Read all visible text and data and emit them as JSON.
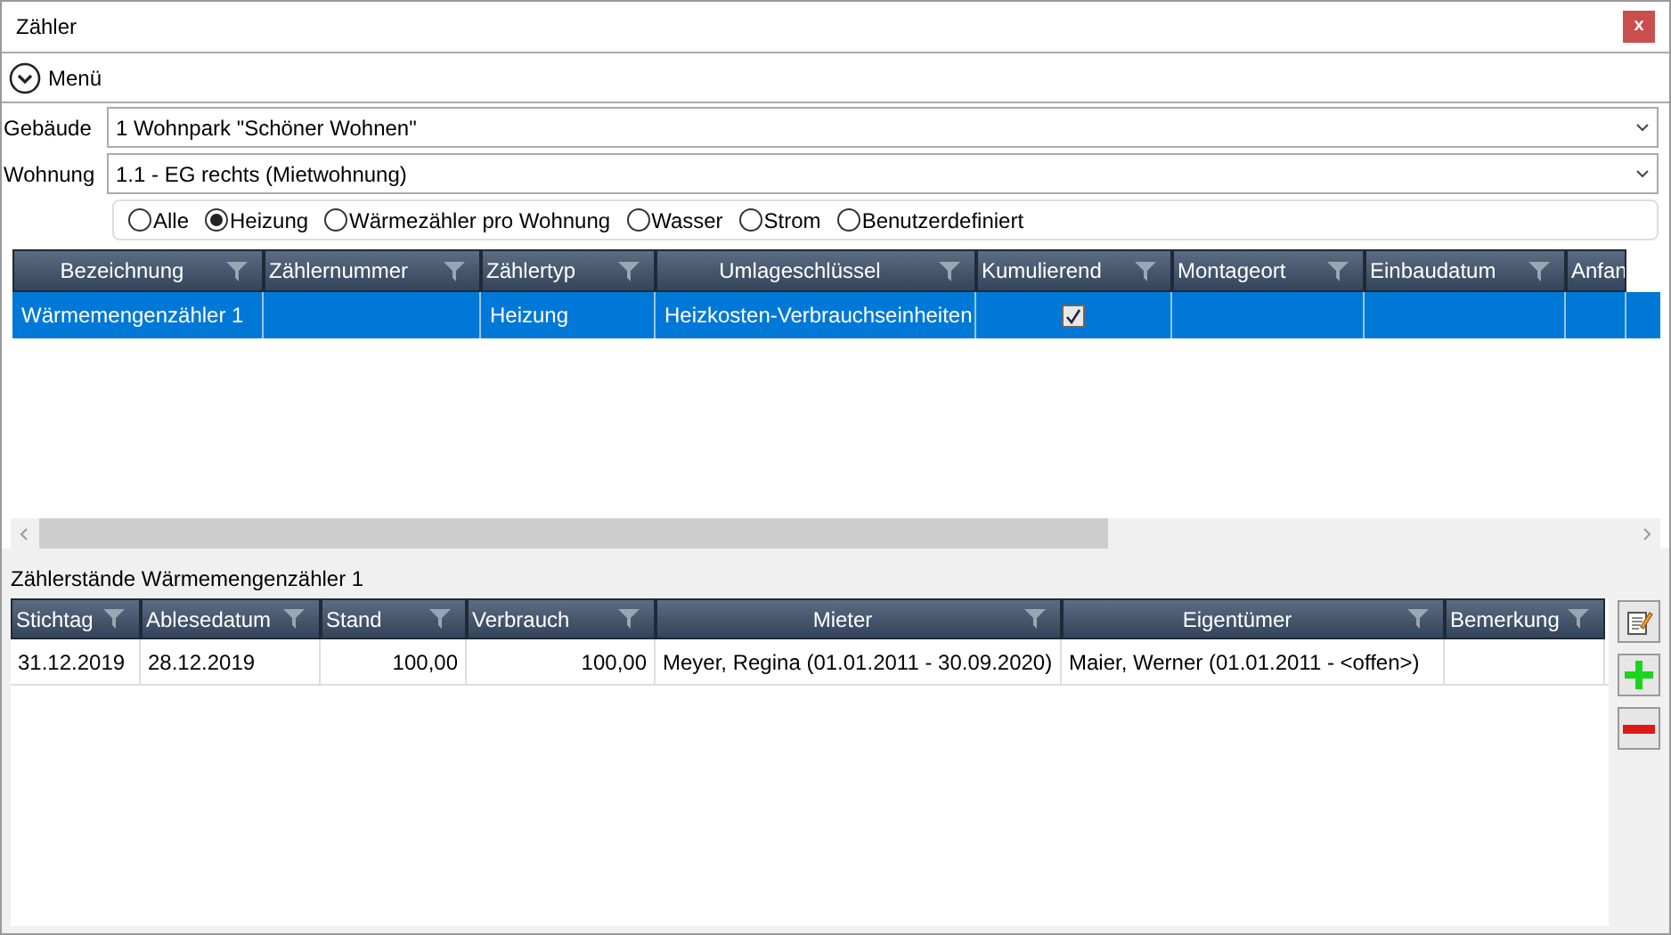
{
  "window": {
    "title": "Zähler",
    "close": "x"
  },
  "menu": {
    "label": "Menü"
  },
  "fields": [
    {
      "label": "Gebäude",
      "value": "1 Wohnpark \"Schöner Wohnen\""
    },
    {
      "label": "Wohnung",
      "value": "1.1 - EG rechts (Mietwohnung)"
    }
  ],
  "filters": [
    {
      "label": "Alle",
      "selected": false
    },
    {
      "label": "Heizung",
      "selected": true
    },
    {
      "label": "Wärmezähler pro Wohnung",
      "selected": false
    },
    {
      "label": "Wasser",
      "selected": false
    },
    {
      "label": "Strom",
      "selected": false
    },
    {
      "label": "Benutzerdefiniert",
      "selected": false
    }
  ],
  "meters_table": {
    "columns": [
      {
        "label": "Bezeichnung",
        "centered": true
      },
      {
        "label": "Zählernummer",
        "centered": false
      },
      {
        "label": "Zählertyp",
        "centered": false
      },
      {
        "label": "Umlageschlüssel",
        "centered": true
      },
      {
        "label": "Kumulierend",
        "centered": false
      },
      {
        "label": "Montageort",
        "centered": false
      },
      {
        "label": "Einbaudatum",
        "centered": false
      },
      {
        "label": "Anfan"
      }
    ],
    "rows": [
      {
        "selected": true,
        "cells": [
          {
            "kind": "text",
            "text": "Wärmemengenzähler 1"
          },
          {
            "kind": "text",
            "text": ""
          },
          {
            "kind": "text",
            "text": "Heizung"
          },
          {
            "kind": "text",
            "text": "Heizkosten-Verbrauchseinheiten"
          },
          {
            "kind": "checkbox",
            "checked": true
          },
          {
            "kind": "text",
            "text": ""
          },
          {
            "kind": "text",
            "text": ""
          },
          {
            "kind": "text",
            "text": ""
          }
        ]
      }
    ]
  },
  "readings_title": "Zählerstände Wärmemengenzähler 1",
  "readings_table": {
    "columns": [
      {
        "label": "Stichtag",
        "centered": false
      },
      {
        "label": "Ablesedatum",
        "centered": false
      },
      {
        "label": "Stand",
        "centered": false,
        "numeric": true
      },
      {
        "label": "Verbrauch",
        "centered": false,
        "numeric": true
      },
      {
        "label": "Mieter",
        "centered": true
      },
      {
        "label": "Eigentümer",
        "centered": true
      },
      {
        "label": "Bemerkung",
        "centered": false
      }
    ],
    "rows": [
      [
        "31.12.2019",
        "28.12.2019",
        "100,00",
        "100,00",
        "Meyer, Regina (01.01.2011 - 30.09.2020)",
        "Maier, Werner (01.01.2011 - <offen>)",
        ""
      ]
    ]
  }
}
